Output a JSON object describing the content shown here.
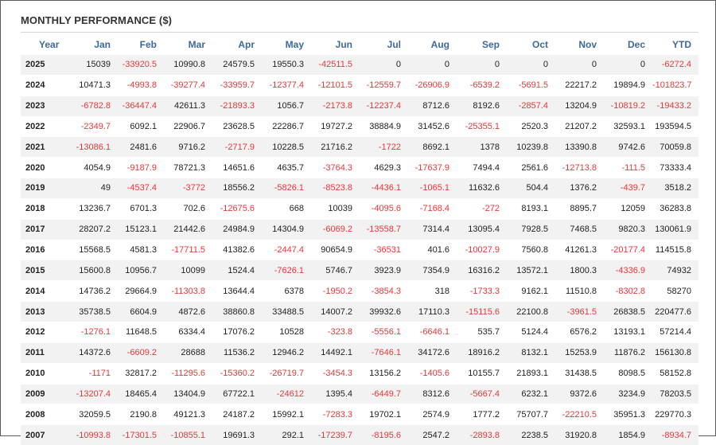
{
  "title": "MONTHLY PERFORMANCE ($)",
  "columns": [
    "Year",
    "Jan",
    "Feb",
    "Mar",
    "Apr",
    "May",
    "Jun",
    "Jul",
    "Aug",
    "Sep",
    "Oct",
    "Nov",
    "Dec",
    "YTD"
  ],
  "rows": [
    {
      "year": "2025",
      "values": [
        "15039",
        "-33920.5",
        "10990.8",
        "24579.5",
        "19550.3",
        "-42511.5",
        "0",
        "0",
        "0",
        "0",
        "0",
        "0",
        "-6272.4"
      ]
    },
    {
      "year": "2024",
      "values": [
        "10471.3",
        "-4993.8",
        "-39277.4",
        "-33959.7",
        "-12377.4",
        "-12101.5",
        "-12559.7",
        "-26906.9",
        "-6539.2",
        "-5691.5",
        "22217.2",
        "19894.9",
        "-101823.7"
      ]
    },
    {
      "year": "2023",
      "values": [
        "-6782.8",
        "-36447.4",
        "42611.3",
        "-21893.3",
        "1056.7",
        "-2173.8",
        "-12237.4",
        "8712.6",
        "8192.6",
        "-2857.4",
        "13204.9",
        "-10819.2",
        "-19433.2"
      ]
    },
    {
      "year": "2022",
      "values": [
        "-2349.7",
        "6092.1",
        "22906.7",
        "23628.5",
        "22286.7",
        "19727.2",
        "38884.9",
        "31452.6",
        "-25355.1",
        "2520.3",
        "21207.2",
        "32593.1",
        "193594.5"
      ]
    },
    {
      "year": "2021",
      "values": [
        "-13086.1",
        "2481.6",
        "9716.2",
        "-2717.9",
        "10228.5",
        "21716.2",
        "-1722",
        "8692.1",
        "1378",
        "10239.8",
        "13390.8",
        "9742.6",
        "70059.8"
      ]
    },
    {
      "year": "2020",
      "values": [
        "4054.9",
        "-9187.9",
        "78721.3",
        "14651.6",
        "4635.7",
        "-3764.3",
        "4629.3",
        "-17637.9",
        "7494.4",
        "2561.6",
        "-12713.8",
        "-111.5",
        "73333.4"
      ]
    },
    {
      "year": "2019",
      "values": [
        "49",
        "-4537.4",
        "-3772",
        "18556.2",
        "-5826.1",
        "-8523.8",
        "-4436.1",
        "-1065.1",
        "11632.6",
        "504.4",
        "1376.2",
        "-439.7",
        "3518.2"
      ]
    },
    {
      "year": "2018",
      "values": [
        "13236.7",
        "6701.3",
        "702.6",
        "-12675.6",
        "668",
        "10039",
        "-4095.6",
        "-7168.4",
        "-272",
        "8193.1",
        "8895.7",
        "12059",
        "36283.8"
      ]
    },
    {
      "year": "2017",
      "values": [
        "28207.2",
        "15123.1",
        "21442.6",
        "24984.9",
        "14304.9",
        "-6069.2",
        "-13558.7",
        "7314.4",
        "13095.4",
        "7928.5",
        "7468.5",
        "9820.3",
        "130061.9"
      ]
    },
    {
      "year": "2016",
      "values": [
        "15568.5",
        "4581.3",
        "-17711.5",
        "41382.6",
        "-2447.4",
        "90654.9",
        "-36531",
        "401.6",
        "-10027.9",
        "7560.8",
        "41261.3",
        "-20177.4",
        "114515.8"
      ]
    },
    {
      "year": "2015",
      "values": [
        "15600.8",
        "10956.7",
        "10099",
        "1524.4",
        "-7626.1",
        "5746.7",
        "3923.9",
        "7354.9",
        "16316.2",
        "13572.1",
        "1800.3",
        "-4336.9",
        "74932"
      ]
    },
    {
      "year": "2014",
      "values": [
        "14736.2",
        "29664.9",
        "-11303.8",
        "13644.4",
        "6378",
        "-1950.2",
        "-3854.3",
        "318",
        "-1733.3",
        "9162.1",
        "11510.8",
        "-8302.8",
        "58270"
      ]
    },
    {
      "year": "2013",
      "values": [
        "35738.5",
        "6604.9",
        "4872.6",
        "38860.8",
        "33488.5",
        "14007.2",
        "39932.6",
        "17110.3",
        "-15115.6",
        "22100.8",
        "-3961.5",
        "26838.5",
        "220477.6"
      ]
    },
    {
      "year": "2012",
      "values": [
        "-1276.1",
        "11648.5",
        "6334.4",
        "17076.2",
        "10528",
        "-323.8",
        "-5556.1",
        "-6646.1",
        "535.7",
        "5124.4",
        "6576.2",
        "13193.1",
        "57214.4"
      ]
    },
    {
      "year": "2011",
      "values": [
        "14372.6",
        "-6609.2",
        "28688",
        "11536.2",
        "12946.2",
        "14492.1",
        "-7646.1",
        "34172.6",
        "18916.2",
        "8132.1",
        "15253.9",
        "11876.2",
        "156130.8"
      ]
    },
    {
      "year": "2010",
      "values": [
        "-1171",
        "32817.2",
        "-11295.6",
        "-15360.2",
        "-26719.7",
        "-3454.3",
        "13156.2",
        "-1405.6",
        "10155.7",
        "21893.1",
        "31438.5",
        "8098.5",
        "58152.8"
      ]
    },
    {
      "year": "2009",
      "values": [
        "-13207.4",
        "18465.4",
        "13404.9",
        "67722.1",
        "-24612",
        "1395.4",
        "-6449.7",
        "8312.6",
        "-5667.4",
        "6232.1",
        "9372.6",
        "3234.9",
        "78203.5"
      ]
    },
    {
      "year": "2008",
      "values": [
        "32059.5",
        "2190.8",
        "49121.3",
        "24187.2",
        "15992.1",
        "-7283.3",
        "19702.1",
        "2574.9",
        "1777.2",
        "75707.7",
        "-22210.5",
        "35951.3",
        "229770.3"
      ]
    },
    {
      "year": "2007",
      "values": [
        "-10993.8",
        "-17301.5",
        "-10855.1",
        "19691.3",
        "292.1",
        "-17239.7",
        "-8195.6",
        "2547.2",
        "-2893.8",
        "2238.5",
        "31920.8",
        "1854.9",
        "-8934.7"
      ]
    }
  ],
  "colors": {
    "header_text": "#3d6a9c",
    "negative": "#e8383a",
    "positive": "#222222",
    "row_stripe": "#f2f2f2"
  }
}
